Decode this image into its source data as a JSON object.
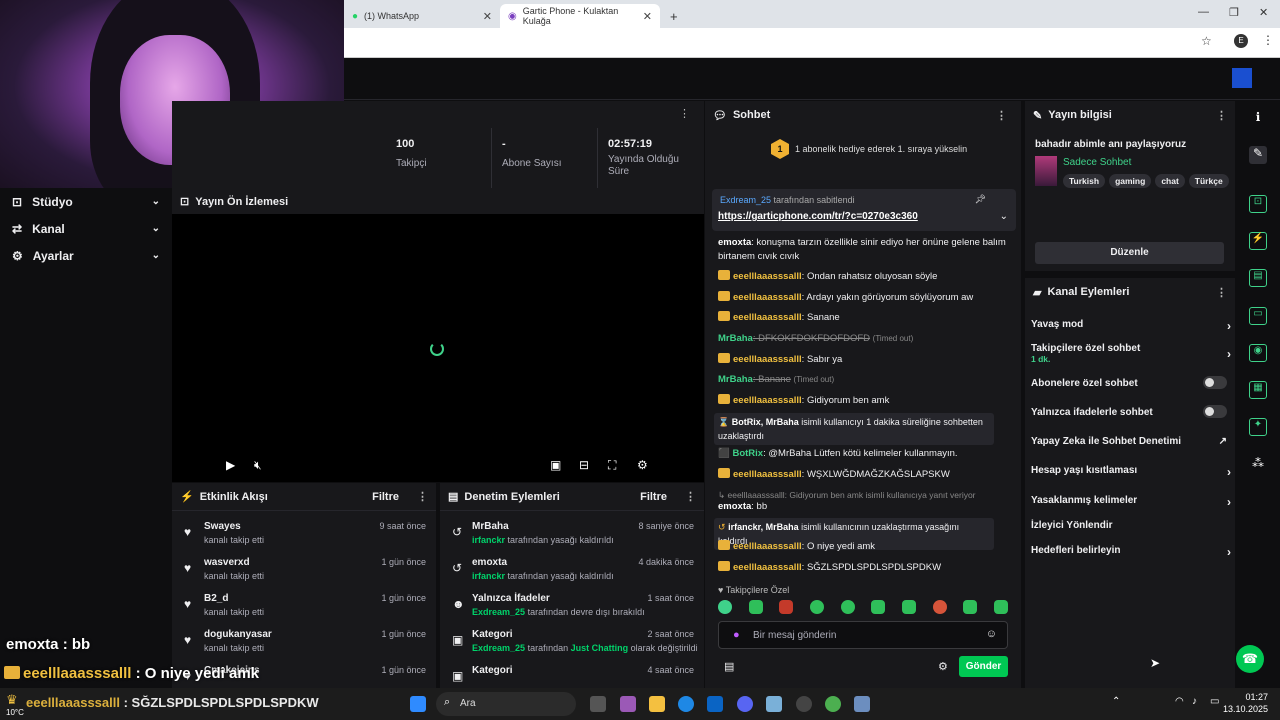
{
  "browser": {
    "tabs": [
      {
        "label": "(1) WhatsApp"
      },
      {
        "label": "Gartic Phone - Kulaktan Kulağa"
      }
    ],
    "new_tab": "+",
    "profile": "E"
  },
  "sidebar": {
    "items": [
      {
        "label": "Stüdyo"
      },
      {
        "label": "Kanal"
      },
      {
        "label": "Ayarlar"
      }
    ]
  },
  "stats": [
    {
      "value": "100",
      "label": "Takipçi"
    },
    {
      "value": "-",
      "label": "Abone Sayısı"
    },
    {
      "value": "02:57:19",
      "label": "Yayında Olduğu Süre"
    }
  ],
  "preview": {
    "title": "Yayın Ön İzlemesi"
  },
  "activity": {
    "title": "Etkinlik Akışı",
    "filter": "Filtre",
    "items": [
      {
        "name": "Swayes",
        "desc": "kanalı takip etti",
        "time": "9 saat önce"
      },
      {
        "name": "wasverxd",
        "desc": "kanalı takip etti",
        "time": "1 gün önce"
      },
      {
        "name": "B2_d",
        "desc": "kanalı takip etti",
        "time": "1 gün önce"
      },
      {
        "name": "dogukanyasar",
        "desc": "kanalı takip etti",
        "time": "1 gün önce"
      },
      {
        "name": "Cmakejeins",
        "desc": "",
        "time": "1 gün önce"
      }
    ]
  },
  "moderation": {
    "title": "Denetim Eylemleri",
    "filter": "Filtre",
    "items": [
      {
        "name": "MrBaha",
        "actor": "irfanckr",
        "desc": "tarafından yasağı kaldırıldı",
        "time": "8 saniye önce"
      },
      {
        "name": "emoxta",
        "actor": "irfanckr",
        "desc": "tarafından yasağı kaldırıldı",
        "time": "4 dakika önce"
      },
      {
        "name": "Yalnızca İfadeler",
        "actor": "Exdream_25",
        "desc": "tarafından devre dışı bırakıldı",
        "time": "1 saat önce"
      },
      {
        "name": "Kategori",
        "actor": "Exdream_25",
        "desc": "tarafından",
        "extra": "Just Chatting",
        "desc2": "olarak değiştirildi",
        "time": "2 saat önce"
      },
      {
        "name": "Kategori",
        "actor": "",
        "desc": "",
        "time": "4 saat önce"
      }
    ]
  },
  "chat": {
    "title": "Sohbet",
    "gift_rank": "1",
    "gift_text": "1 abonelik hediye ederek 1. sıraya yükselin",
    "pinned_by": "Exdream_25",
    "pinned_suffix": "tarafından sabitlendi",
    "pinned_link": "https://garticphone.com/tr/?c=0270e3c360",
    "messages": [
      {
        "user": "emoxta",
        "text": ": konuşma tarzın özellikle sinir ediyo her önüne gelene balım birtanem cıvık cıvık"
      },
      {
        "user": "eeelllaaasssalll",
        "text": ": Ondan rahatsız oluyosan söyle"
      },
      {
        "user": "eeelllaaasssalll",
        "text": ": Ardayı yakın görüyorum söylüyorum aw"
      },
      {
        "user": "eeelllaaasssalll",
        "text": ": Sanane"
      },
      {
        "user": "MrBaha",
        "text": ": DFKOKFDOKFDOFDOFD",
        "note": "(Timed out)"
      },
      {
        "user": "eeelllaaasssalll",
        "text": ": Sabır ya"
      },
      {
        "user": "MrBaha",
        "text": ": Banane",
        "note": "(Timed out)"
      },
      {
        "user": "eeelllaaasssalll",
        "text": ": Gidiyorum ben amk"
      },
      {
        "user": "BotRix, MrBaha",
        "text": "isimli kullanıcıyı 1 dakika süreliğine sohbetten uzaklaştırdı"
      },
      {
        "user": "BotRix",
        "text": ": @MrBaha Lütfen kötü kelimeler kullanmayın."
      },
      {
        "user": "eeelllaaasssalll",
        "text": ": WŞXLWĞDMAĞZKAĞSLAPSKW"
      },
      {
        "user": "eeelllaaasssalll",
        "text": ": Gidiyorum ben amk isimli kullanıcıya yanıt veriyor"
      },
      {
        "user": "emoxta",
        "text": ": bb"
      },
      {
        "user": "irfanckr, MrBaha",
        "text": "isimli kullanıcının uzaklaştırma yasağını kaldırdı"
      },
      {
        "user": "eeelllaaasssalll",
        "text": ": O niye yedi amk"
      },
      {
        "user": "eeelllaaasssalll",
        "text": ": SĞZLSPDLSPDLSPDLSPDKW"
      }
    ],
    "followers_only": "Takipçilere Özel",
    "input_placeholder": "Bir mesaj gönderin",
    "send": "Gönder"
  },
  "stream_info": {
    "title": "Yayın bilgisi",
    "stream_title": "bahadır abimle anı paylaşıyoruz",
    "category": "Sadece Sohbet",
    "tags": [
      "Turkish",
      "gaming",
      "chat",
      "Türkçe"
    ],
    "edit": "Düzenle"
  },
  "channel_actions": {
    "title": "Kanal Eylemleri",
    "items": [
      {
        "label": "Yavaş mod"
      },
      {
        "label": "Takipçilere özel sohbet",
        "sub": "1 dk."
      },
      {
        "label": "Abonelere özel sohbet"
      },
      {
        "label": "Yalnızca ifadelerle sohbet"
      },
      {
        "label": "Yapay Zeka ile Sohbet Denetimi"
      },
      {
        "label": "Hesap yaşı kısıtlaması"
      },
      {
        "label": "Yasaklanmış kelimeler"
      },
      {
        "label": "İzleyici Yönlendir"
      },
      {
        "label": "Hedefleri belirleyin"
      }
    ]
  },
  "overlay": {
    "line1_user": "emoxta",
    "line1_text": ": bb",
    "line2_user": "eeelllaaasssalll",
    "line2_text": ": O niye yedi amk",
    "line3_user": "eeelllaaasssalll",
    "line3_text": ": SĞZLSPDLSPDLSPDLSPDKW"
  },
  "taskbar": {
    "weather": "10°C",
    "search": "Ara",
    "time": "01:27",
    "date": "13.10.2025"
  }
}
